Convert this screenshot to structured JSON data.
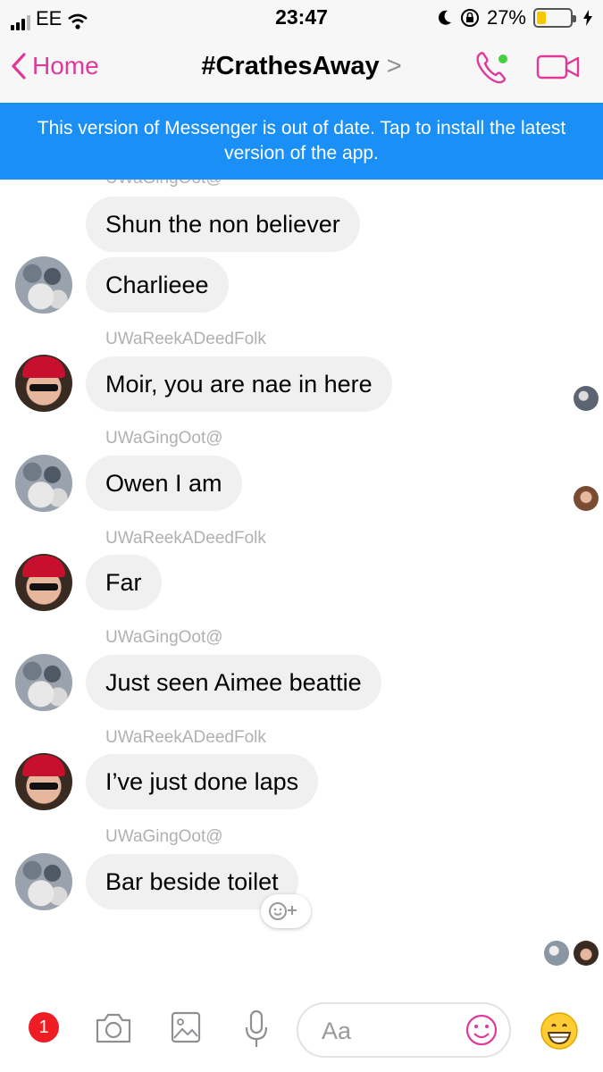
{
  "status_bar": {
    "carrier": "EE",
    "time": "23:47",
    "battery_percent": "27%",
    "battery_level": 0.27,
    "icons": [
      "signal-icon",
      "wifi-icon",
      "moon-icon",
      "rotation-lock-icon",
      "battery-icon",
      "charging-bolt-icon"
    ]
  },
  "nav": {
    "back_label": "Home",
    "title": "#CrathesAway",
    "title_chevron": ">",
    "accent_color": "#e0399a"
  },
  "banner": {
    "text": "This version of Messenger is out of date. Tap to install the latest version of the app.",
    "color": "#1a8ff5"
  },
  "messages": [
    {
      "sender": "",
      "text": "Shun the non believer",
      "avatar": ""
    },
    {
      "sender": "",
      "text": "Charlieee",
      "avatar": "group-photo"
    },
    {
      "sender": "UWaReekADeedFolk",
      "text": "Moir, you are nae in here",
      "avatar": "red-cap-photo"
    },
    {
      "sender": "UWaGingOot@",
      "text": "Owen I am",
      "avatar": "group-photo"
    },
    {
      "sender": "UWaReekADeedFolk",
      "text": "Far",
      "avatar": "red-cap-photo"
    },
    {
      "sender": "UWaGingOot@",
      "text": "Just seen Aimee beattie",
      "avatar": "group-photo"
    },
    {
      "sender": "UWaReekADeedFolk",
      "text": "I’ve just done laps",
      "avatar": "red-cap-photo"
    },
    {
      "sender": "UWaGingOot@",
      "text": "Bar beside toilet",
      "avatar": "group-photo"
    }
  ],
  "composer": {
    "badge_count": "1",
    "placeholder": "Aa",
    "icons": [
      "camera-icon",
      "photo-icon",
      "microphone-icon",
      "smiley-icon",
      "grinning-emoji-icon"
    ]
  }
}
